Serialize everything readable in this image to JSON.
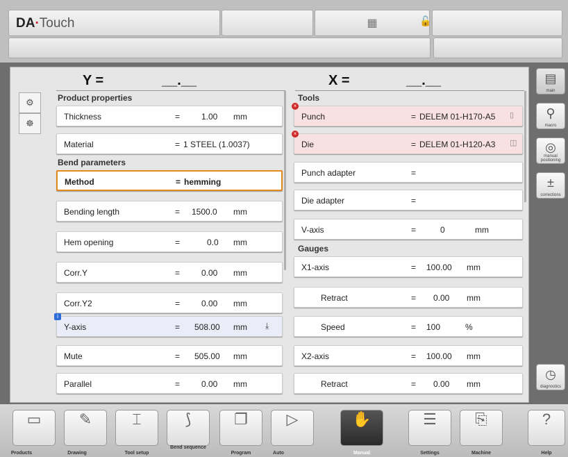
{
  "app": {
    "brand_a": "DA",
    "brand_dot": "·",
    "brand_b": "Touch"
  },
  "axes": {
    "y_label": "Y  =",
    "y_value": "__.__",
    "x_label": "X  =",
    "x_value": "__.__"
  },
  "left": {
    "product_header": "Product properties",
    "bend_header": "Bend parameters",
    "rows": [
      {
        "label": "Thickness",
        "eq": "=",
        "value": "1.00",
        "unit": "mm"
      },
      {
        "label": "Material",
        "eq": "=",
        "value": "1 STEEL (1.0037)",
        "unit": ""
      },
      {
        "label": "Method",
        "eq": "=",
        "value": "hemming",
        "unit": ""
      },
      {
        "label": "Bending length",
        "eq": "=",
        "value": "1500.0",
        "unit": "mm"
      },
      {
        "label": "Hem opening",
        "eq": "=",
        "value": "0.0",
        "unit": "mm"
      },
      {
        "label": "Corr.Y",
        "eq": "=",
        "value": "0.00",
        "unit": "mm"
      },
      {
        "label": "Corr.Y2",
        "eq": "=",
        "value": "0.00",
        "unit": "mm"
      },
      {
        "label": "Y-axis",
        "eq": "=",
        "value": "508.00",
        "unit": "mm"
      },
      {
        "label": "Mute",
        "eq": "=",
        "value": "505.00",
        "unit": "mm"
      },
      {
        "label": "Parallel",
        "eq": "=",
        "value": "0.00",
        "unit": "mm"
      }
    ]
  },
  "right": {
    "tools_header": "Tools",
    "gauges_header": "Gauges",
    "rows": [
      {
        "label": "Punch",
        "eq": "=",
        "value": "DELEM 01-H170-A5",
        "unit": ""
      },
      {
        "label": "Die",
        "eq": "=",
        "value": "DELEM 01-H120-A3",
        "unit": ""
      },
      {
        "label": "Punch adapter",
        "eq": "=",
        "value": "",
        "unit": ""
      },
      {
        "label": "Die adapter",
        "eq": "=",
        "value": "",
        "unit": ""
      },
      {
        "label": "V-axis",
        "eq": "=",
        "value": "0",
        "unit": "mm"
      },
      {
        "label": "X1-axis",
        "eq": "=",
        "value": "100.00",
        "unit": "mm"
      },
      {
        "label": "Retract",
        "eq": "=",
        "value": "0.00",
        "unit": "mm"
      },
      {
        "label": "Speed",
        "eq": "=",
        "value": "100",
        "unit": "%"
      },
      {
        "label": "X2-axis",
        "eq": "=",
        "value": "100.00",
        "unit": "mm"
      },
      {
        "label": "Retract",
        "eq": "=",
        "value": "0.00",
        "unit": "mm"
      }
    ]
  },
  "side_buttons": {
    "main": "main",
    "macro": "macro",
    "manual_positioning": "manual positioning",
    "corrections": "corrections",
    "diagnostics": "diagnostics"
  },
  "bottom_nav": [
    "Products",
    "Drawing",
    "Tool setup",
    "Bend sequence",
    "Program",
    "Auto",
    "Manual",
    "Settings",
    "Machine",
    "Help"
  ]
}
